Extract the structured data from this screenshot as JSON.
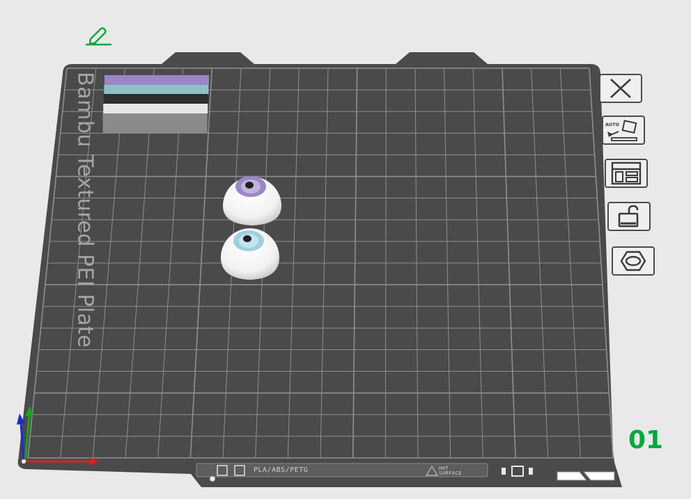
{
  "plate": {
    "label": "Bambu Textured PEI Plate",
    "number": "01",
    "material_text": "PLA/ABS/PETG",
    "hot_line1": "HOT",
    "hot_line2": "SURFACE"
  },
  "toolbar": [
    {
      "id": "close",
      "icon": "close-x-icon"
    },
    {
      "id": "auto-orient",
      "icon": "auto-orient-icon",
      "badge": "AUTO"
    },
    {
      "id": "arrange",
      "icon": "arrange-layout-icon"
    },
    {
      "id": "lock",
      "icon": "unlock-icon"
    },
    {
      "id": "settings",
      "icon": "hex-nut-icon"
    }
  ],
  "colors": {
    "plate": "#4a4a4a",
    "grid": "#8f8f8f",
    "accent_green": "#00a83c",
    "axis_x": "#d62020",
    "axis_y": "#20a020",
    "axis_z": "#1a2bd0",
    "iris_purple": "#9b86c6",
    "iris_blue": "#9ed0df"
  },
  "wipe_tower_layers": [
    "#9b86c6",
    "#8fc0c8",
    "#2e2e2e",
    "#e6e6e6",
    "#8a8a8a"
  ]
}
